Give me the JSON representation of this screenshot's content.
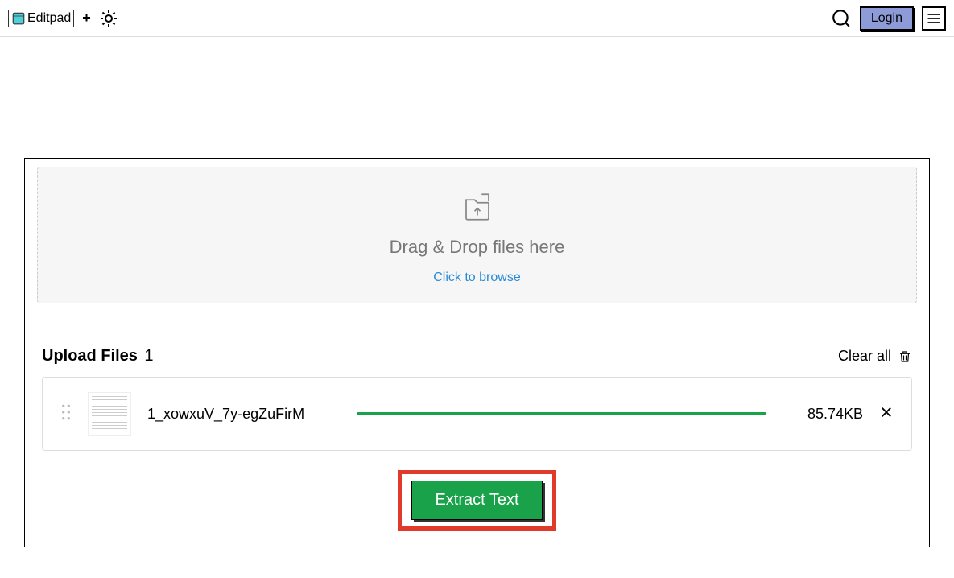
{
  "header": {
    "logo_text": "Editpad",
    "login_label": "Login"
  },
  "dropzone": {
    "title": "Drag & Drop files here",
    "browse_label": "Click to browse"
  },
  "files": {
    "title": "Upload Files",
    "count": "1",
    "clear_label": "Clear all",
    "items": [
      {
        "name": "1_xowxuV_7y-egZuFirM",
        "size": "85.74KB"
      }
    ]
  },
  "actions": {
    "extract_label": "Extract Text"
  }
}
